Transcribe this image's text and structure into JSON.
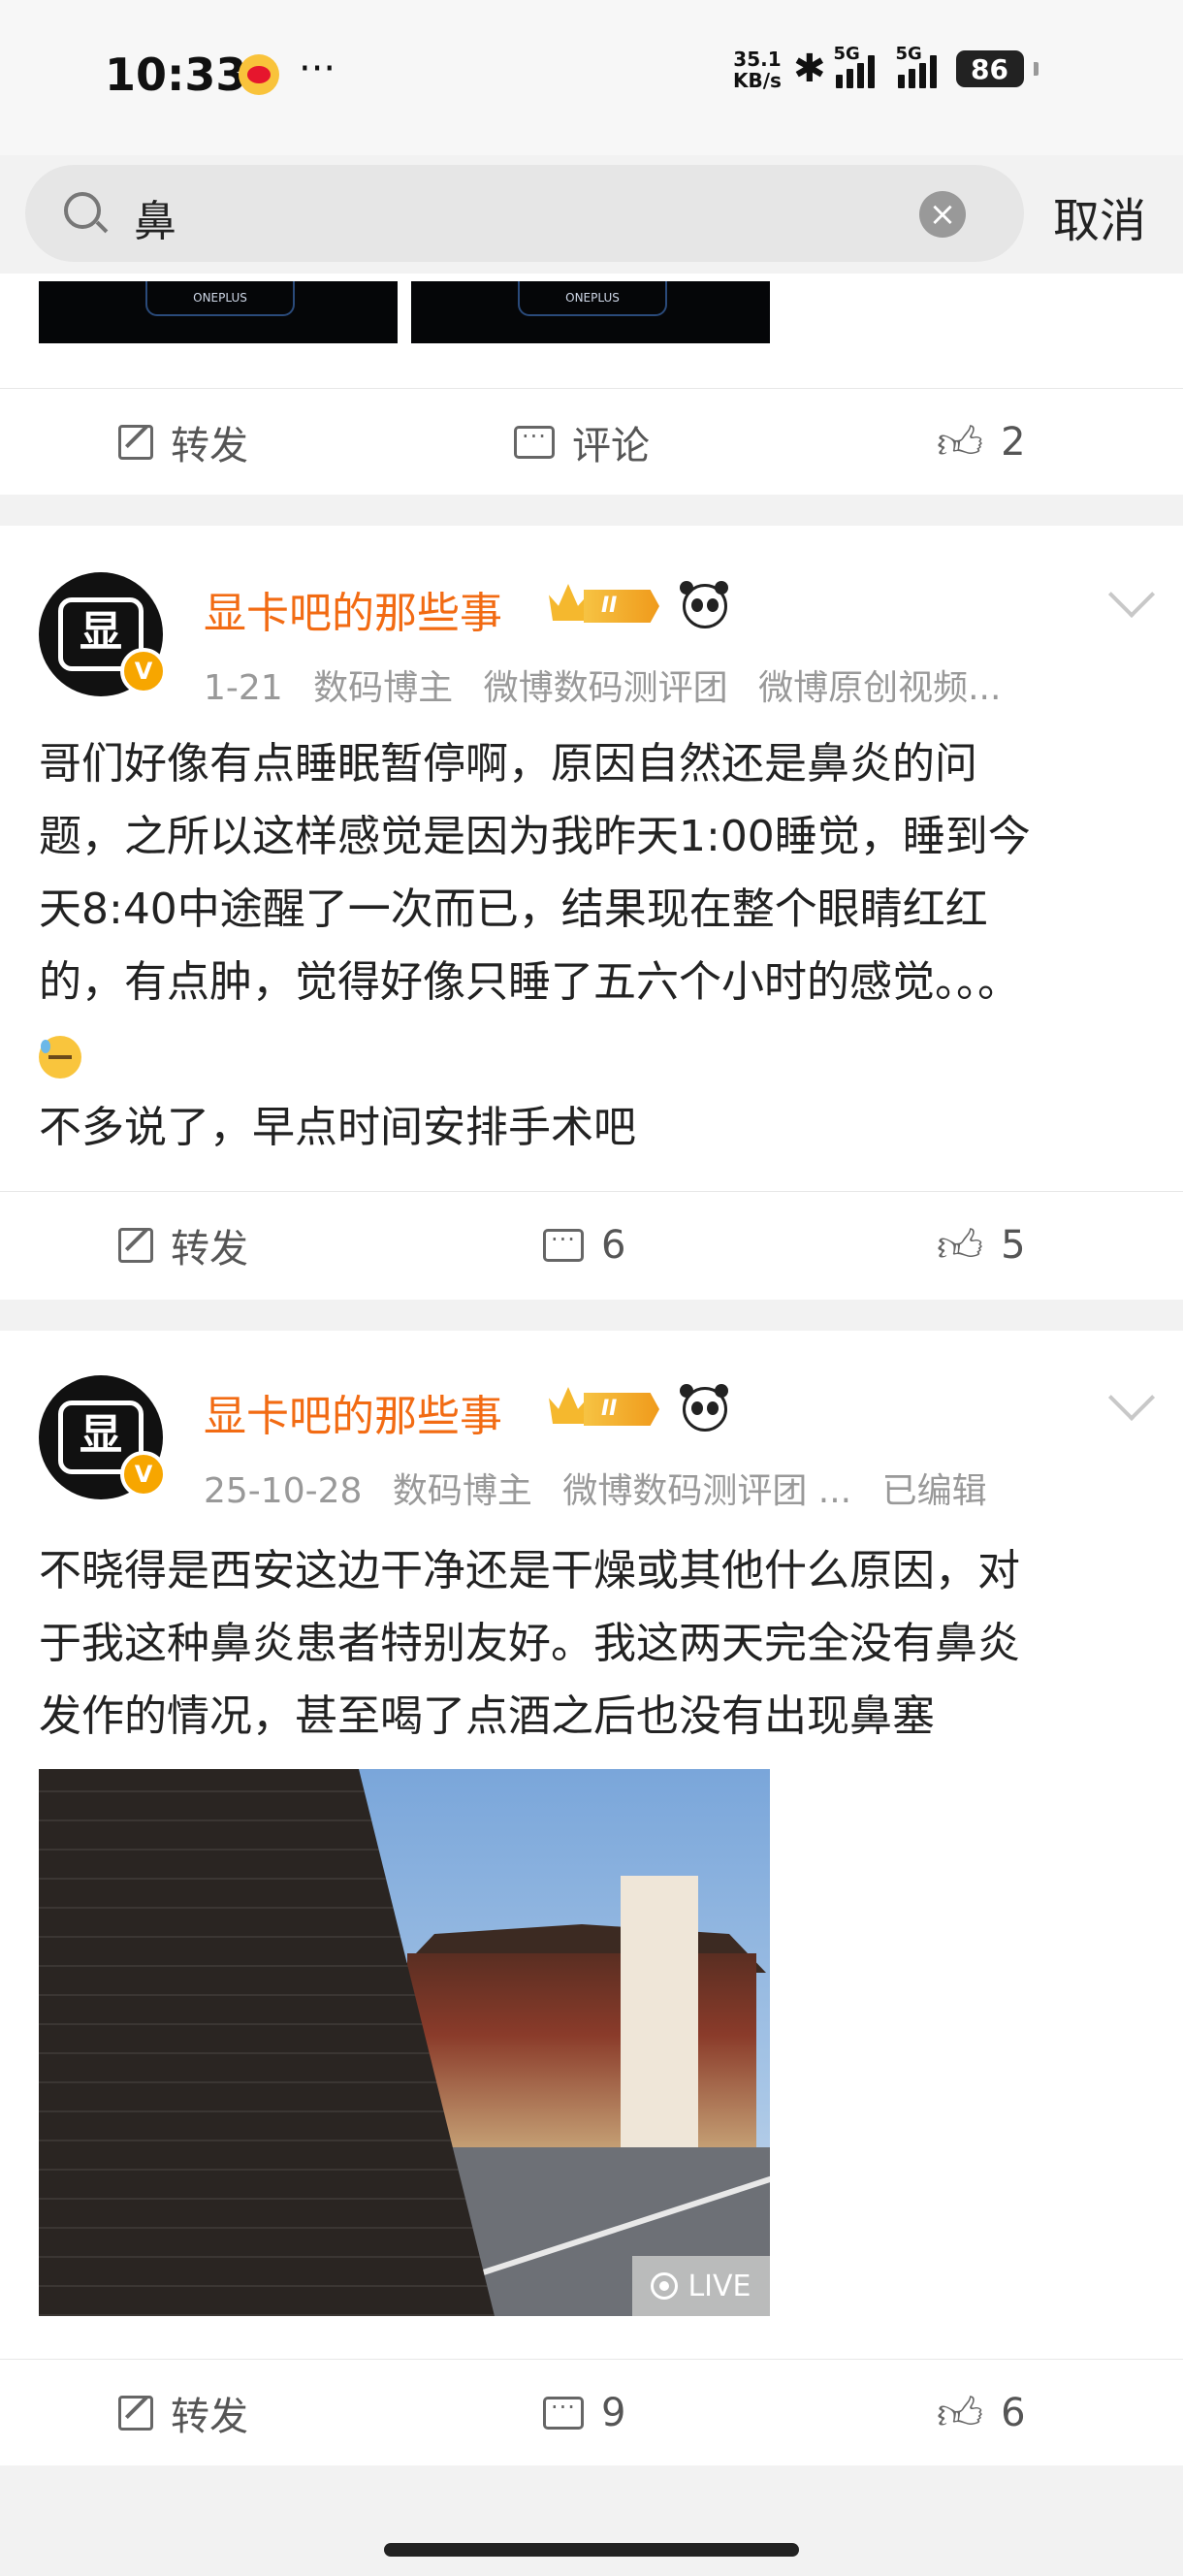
{
  "status_bar": {
    "time": "10:33",
    "notification_icon": "weibo-icon",
    "more": "···",
    "net_speed_value": "35.1",
    "net_speed_unit": "KB/s",
    "sim1": "5G",
    "sim2": "5G",
    "battery": "86"
  },
  "search": {
    "query": "鼻",
    "cancel_label": "取消"
  },
  "first_card": {
    "thumb_label": "ONEPLUS",
    "actions": {
      "repost": "转发",
      "comment": "评论",
      "like": "2"
    }
  },
  "posts": [
    {
      "username": "显卡吧的那些事",
      "level": "II",
      "avatar_glyph": "显",
      "verified_glyph": "V",
      "meta": [
        "1-21",
        "数码博主",
        "微博数码测评团",
        "微博原创视频..."
      ],
      "lines": [
        "哥们好像有点睡眠暂停啊，原因自然还是鼻炎的问",
        "题，之所以这样感觉是因为我昨天1:00睡觉，睡到今",
        "天8:40中途醒了一次而已，结果现在整个眼睛红红",
        "的，有点肿，觉得好像只睡了五六个小时的感觉。。。",
        "不多说了，早点时间安排手术吧"
      ],
      "actions": {
        "repost": "转发",
        "comment": "6",
        "like": "5"
      }
    },
    {
      "username": "显卡吧的那些事",
      "level": "II",
      "avatar_glyph": "显",
      "verified_glyph": "V",
      "meta": [
        "25-10-28",
        "数码博主",
        "微博数码测评团 ...",
        "已编辑"
      ],
      "lines": [
        "不晓得是西安这边干净还是干燥或其他什么原因，对",
        "于我这种鼻炎患者特别友好。我这两天完全没有鼻炎",
        "发作的情况，甚至喝了点酒之后也没有出现鼻塞"
      ],
      "photo_badge": "LIVE",
      "actions": {
        "repost": "转发",
        "comment": "9",
        "like": "6"
      }
    }
  ]
}
